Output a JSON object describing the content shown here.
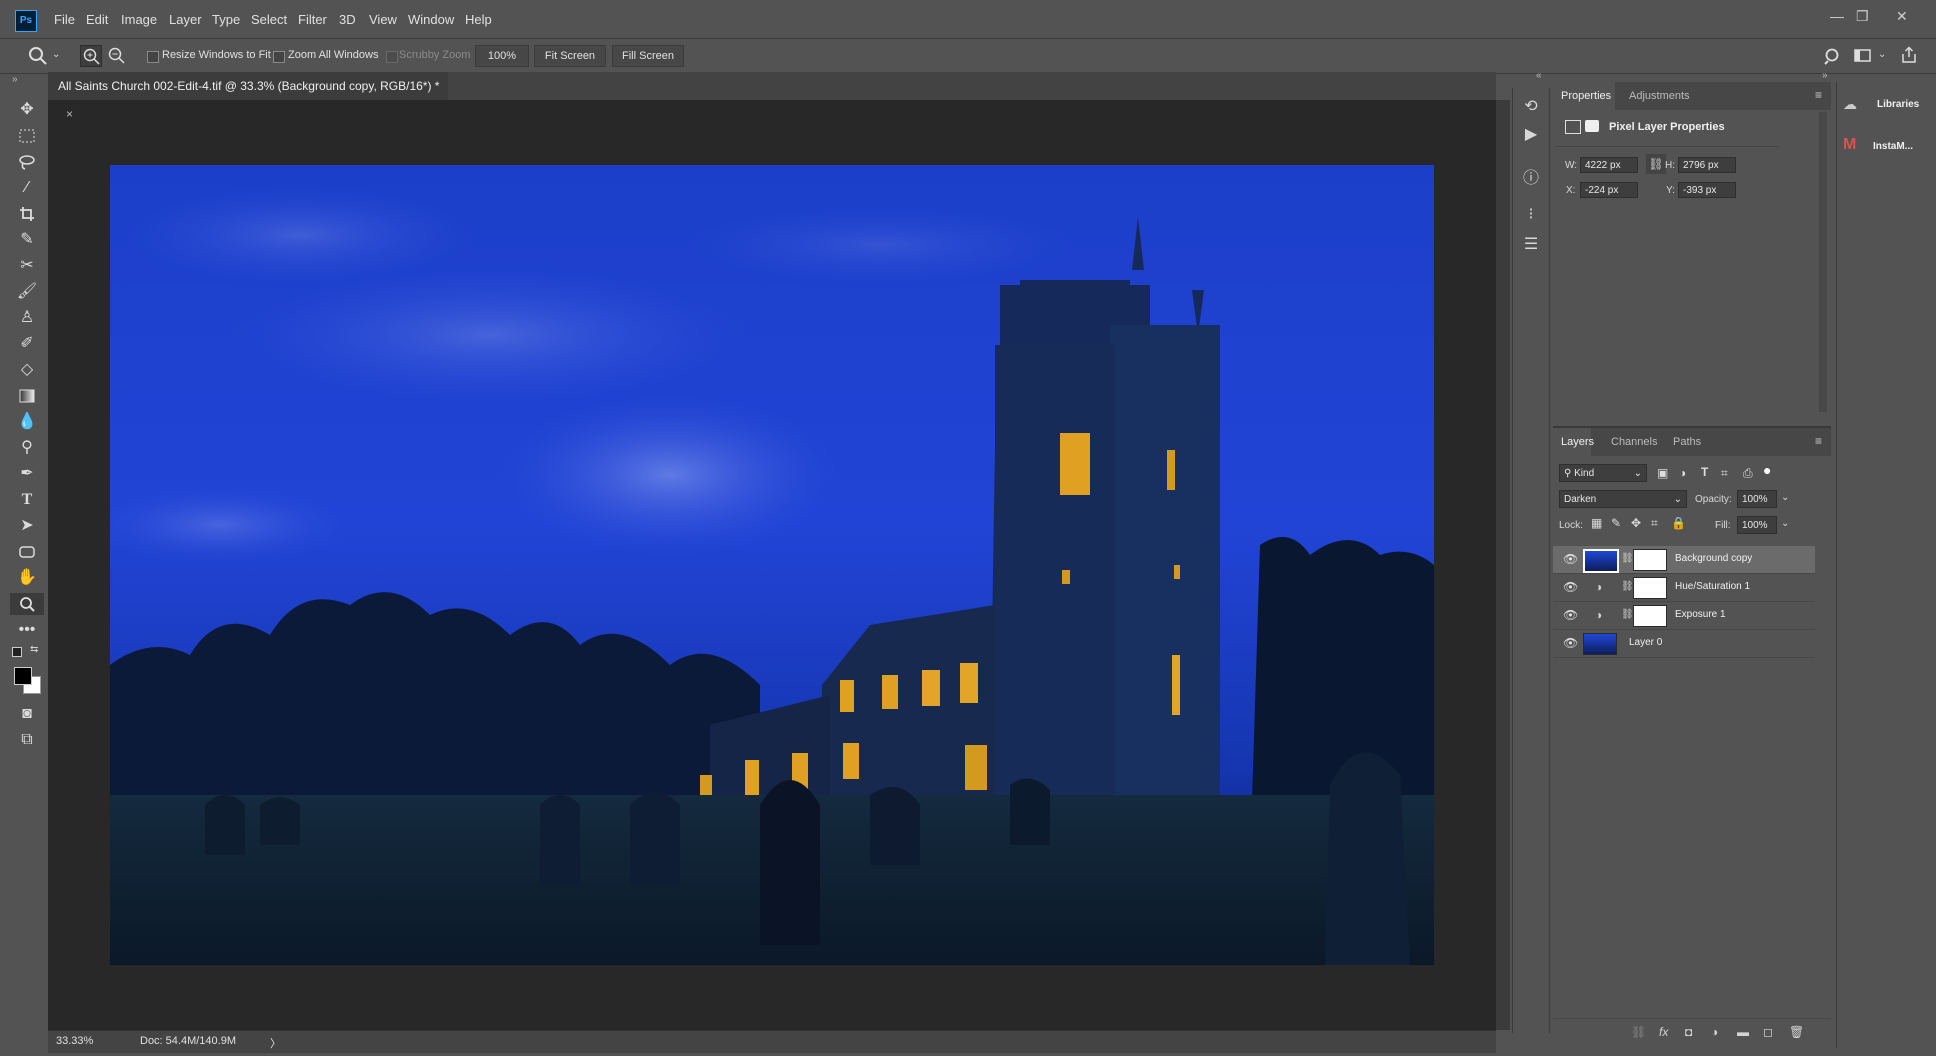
{
  "menu": {
    "logo": "Ps",
    "items": [
      "File",
      "Edit",
      "Image",
      "Layer",
      "Type",
      "Select",
      "Filter",
      "3D",
      "View",
      "Window",
      "Help"
    ],
    "window_controls": [
      "—",
      "❐",
      "✕"
    ]
  },
  "options": {
    "resize_windows": "Resize Windows to Fit",
    "zoom_all": "Zoom All Windows",
    "scrubby_zoom": "Scrubby Zoom",
    "zoom_value": "100%",
    "fit_screen": "Fit Screen",
    "fill_screen": "Fill Screen"
  },
  "document": {
    "tab_title": "All Saints Church 002-Edit-4.tif @ 33.3% (Background copy, RGB/16*) *",
    "close": "×"
  },
  "status": {
    "zoom": "33.33%",
    "doc": "Doc: 54.4M/140.9M",
    "arrow": "〉"
  },
  "properties": {
    "tabs": [
      "Properties",
      "Adjustments"
    ],
    "title": "Pixel Layer Properties",
    "w_label": "W:",
    "w": "4222 px",
    "h_label": "H:",
    "h": "2796 px",
    "x_label": "X:",
    "x": "-224 px",
    "y_label": "Y:",
    "y": "-393 px"
  },
  "layers_panel": {
    "tabs": [
      "Layers",
      "Channels",
      "Paths"
    ],
    "filter": "Kind",
    "blend_mode": "Darken",
    "opacity_label": "Opacity:",
    "opacity": "100%",
    "lock_label": "Lock:",
    "fill_label": "Fill:",
    "fill": "100%",
    "layers": [
      {
        "name": "Background copy"
      },
      {
        "name": "Hue/Saturation 1"
      },
      {
        "name": "Exposure 1"
      },
      {
        "name": "Layer 0"
      }
    ],
    "footer_icons": [
      "⛓",
      "fx",
      "◘",
      "◑",
      "▬",
      "◻",
      "🗑"
    ]
  },
  "libraries": {
    "libraries_label": "Libraries",
    "instam_label": "InstaM..."
  }
}
